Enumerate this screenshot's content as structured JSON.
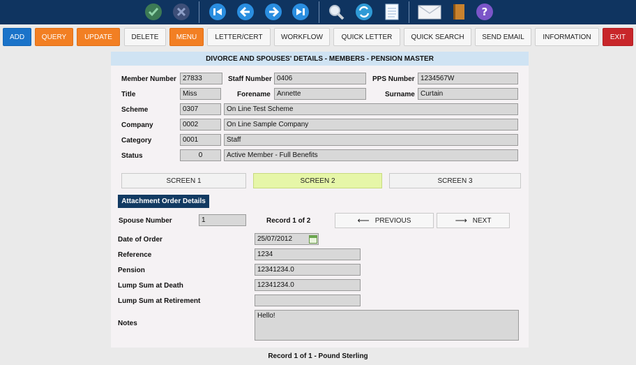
{
  "toolbar_icons": [
    "confirm-icon",
    "cancel-icon",
    "first-record-icon",
    "previous-record-icon",
    "next-record-icon",
    "last-record-icon",
    "search-icon",
    "refresh-icon",
    "notes-icon",
    "email-icon",
    "book-icon",
    "help-icon"
  ],
  "colors": {
    "topbar": "#0f3460",
    "accent_blue": "#1a73c9",
    "accent_orange": "#f27f23",
    "accent_red": "#c8262a",
    "active_tab": "#e6f6a8"
  },
  "buttons": {
    "add": "ADD",
    "query": "QUERY",
    "update": "UPDATE",
    "delete": "DELETE",
    "menu": "MENU",
    "letter_cert": "LETTER/CERT",
    "workflow": "WORKFLOW",
    "quick_letter": "QUICK LETTER",
    "quick_search": "QUICK SEARCH",
    "send_email": "SEND EMAIL",
    "information": "INFORMATION",
    "exit": "EXIT"
  },
  "panel": {
    "title": "DIVORCE AND SPOUSES' DETAILS - MEMBERS - PENSION MASTER"
  },
  "member": {
    "member_number_label": "Member Number",
    "member_number": "27833",
    "staff_number_label": "Staff Number",
    "staff_number": "0406",
    "pps_number_label": "PPS Number",
    "pps_number": "1234567W",
    "title_label": "Title",
    "title": "Miss",
    "forename_label": "Forename",
    "forename": "Annette",
    "surname_label": "Surname",
    "surname": "Curtain",
    "scheme_label": "Scheme",
    "scheme_code": "0307",
    "scheme_name": "On Line Test Scheme",
    "company_label": "Company",
    "company_code": "0002",
    "company_name": "On Line Sample Company",
    "category_label": "Category",
    "category_code": "0001",
    "category_name": "Staff",
    "status_label": "Status",
    "status_code": "0",
    "status_name": "Active Member - Full Benefits"
  },
  "tabs": [
    "SCREEN 1",
    "SCREEN 2",
    "SCREEN 3"
  ],
  "attachment": {
    "section_title": "Attachment Order Details",
    "spouse_number_label": "Spouse Number",
    "spouse_number": "1",
    "record_text": "Record 1 of 2",
    "previous_label": "PREVIOUS",
    "next_label": "NEXT",
    "date_of_order_label": "Date of Order",
    "date_of_order": "25/07/2012",
    "reference_label": "Reference",
    "reference": "1234",
    "pension_label": "Pension",
    "pension": "12341234.0",
    "lump_death_label": "Lump Sum at Death",
    "lump_death": "12341234.0",
    "lump_retirement_label": "Lump Sum at Retirement",
    "lump_retirement": "",
    "notes_label": "Notes",
    "notes": "Hello!"
  },
  "footer": "Record 1 of 1 - Pound Sterling"
}
